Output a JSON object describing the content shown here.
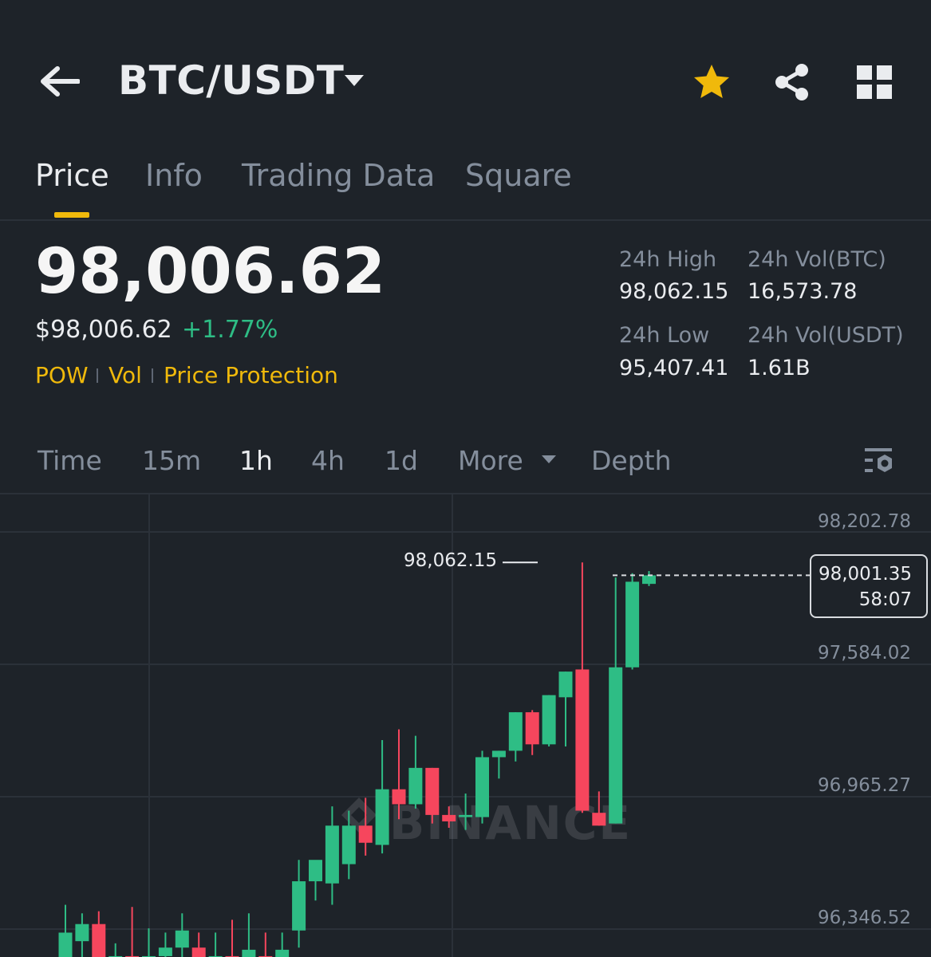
{
  "header": {
    "pair": "BTC/USDT",
    "colors": {
      "favorite": "#f0b90b",
      "icon": "#eaecef"
    }
  },
  "tabs": [
    {
      "label": "Price",
      "active": true
    },
    {
      "label": "Info",
      "active": false
    },
    {
      "label": "Trading Data",
      "active": false
    },
    {
      "label": "Square",
      "active": false
    }
  ],
  "price": {
    "last": "98,006.62",
    "usd": "$98,006.62",
    "change": "+1.77%",
    "tags": [
      "POW",
      "Vol",
      "Price Protection"
    ]
  },
  "stats": {
    "high_label": "24h High",
    "high_value": "98,062.15",
    "low_label": "24h Low",
    "low_value": "95,407.41",
    "vol_btc_label": "24h Vol(BTC)",
    "vol_btc_value": "16,573.78",
    "vol_usdt_label": "24h Vol(USDT)",
    "vol_usdt_value": "1.61B"
  },
  "intervals": {
    "items": [
      {
        "label": "Time",
        "active": false
      },
      {
        "label": "15m",
        "active": false
      },
      {
        "label": "1h",
        "active": true
      },
      {
        "label": "4h",
        "active": false
      },
      {
        "label": "1d",
        "active": false
      }
    ],
    "more": "More",
    "depth": "Depth"
  },
  "chart": {
    "axis_labels": [
      "98,202.78",
      "97,584.02",
      "96,965.27",
      "96,346.52"
    ],
    "current_price": "98,001.35",
    "countdown": "58:07",
    "high_marker": "98,062.15",
    "watermark": "BINANCE",
    "colors": {
      "up": "#2ebd85",
      "down": "#f6465d",
      "grid": "#2b3139"
    }
  },
  "chart_data": {
    "type": "candlestick",
    "y_ticks": [
      98202.78,
      97584.02,
      96965.27,
      96346.52
    ],
    "candles": [
      {
        "o": 96200,
        "h": 96460,
        "l": 96000,
        "c": 96330
      },
      {
        "o": 96290,
        "h": 96420,
        "l": 96180,
        "c": 96370
      },
      {
        "o": 96370,
        "h": 96430,
        "l": 96000,
        "c": 96140
      },
      {
        "o": 96140,
        "h": 96280,
        "l": 96000,
        "c": 96220
      },
      {
        "o": 96220,
        "h": 96450,
        "l": 96000,
        "c": 96170
      },
      {
        "o": 96180,
        "h": 96350,
        "l": 96000,
        "c": 96220
      },
      {
        "o": 96220,
        "h": 96330,
        "l": 96000,
        "c": 96260
      },
      {
        "o": 96260,
        "h": 96420,
        "l": 96140,
        "c": 96340
      },
      {
        "o": 96260,
        "h": 96330,
        "l": 96000,
        "c": 96180
      },
      {
        "o": 96180,
        "h": 96330,
        "l": 96000,
        "c": 96220
      },
      {
        "o": 96220,
        "h": 96390,
        "l": 96000,
        "c": 96120
      },
      {
        "o": 96120,
        "h": 96420,
        "l": 96000,
        "c": 96250
      },
      {
        "o": 96220,
        "h": 96330,
        "l": 96000,
        "c": 96160
      },
      {
        "o": 96110,
        "h": 96330,
        "l": 96000,
        "c": 96250
      },
      {
        "o": 96340,
        "h": 96670,
        "l": 96260,
        "c": 96570
      },
      {
        "o": 96570,
        "h": 96650,
        "l": 96480,
        "c": 96670
      },
      {
        "o": 96560,
        "h": 96920,
        "l": 96460,
        "c": 96830
      },
      {
        "o": 96650,
        "h": 96900,
        "l": 96580,
        "c": 96830
      },
      {
        "o": 96830,
        "h": 96960,
        "l": 96690,
        "c": 96750
      },
      {
        "o": 96740,
        "h": 97230,
        "l": 96700,
        "c": 97000
      },
      {
        "o": 97000,
        "h": 97280,
        "l": 96860,
        "c": 96930
      },
      {
        "o": 96930,
        "h": 97250,
        "l": 96910,
        "c": 97100
      },
      {
        "o": 97100,
        "h": 97100,
        "l": 96840,
        "c": 96880
      },
      {
        "o": 96880,
        "h": 96920,
        "l": 96820,
        "c": 96850
      },
      {
        "o": 96870,
        "h": 96980,
        "l": 96810,
        "c": 96880
      },
      {
        "o": 96870,
        "h": 97180,
        "l": 96840,
        "c": 97150
      },
      {
        "o": 97150,
        "h": 97180,
        "l": 97050,
        "c": 97180
      },
      {
        "o": 97180,
        "h": 97360,
        "l": 97130,
        "c": 97360
      },
      {
        "o": 97360,
        "h": 97370,
        "l": 97160,
        "c": 97210
      },
      {
        "o": 97210,
        "h": 97440,
        "l": 97200,
        "c": 97440
      },
      {
        "o": 97430,
        "h": 97550,
        "l": 97200,
        "c": 97550
      },
      {
        "o": 97560,
        "h": 98060,
        "l": 96890,
        "c": 96900
      },
      {
        "o": 96890,
        "h": 96990,
        "l": 96830,
        "c": 96830
      },
      {
        "o": 96840,
        "h": 97990,
        "l": 96840,
        "c": 97570
      },
      {
        "o": 97570,
        "h": 98010,
        "l": 97560,
        "c": 97970
      },
      {
        "o": 97960,
        "h": 98020,
        "l": 97950,
        "c": 98000
      }
    ]
  }
}
